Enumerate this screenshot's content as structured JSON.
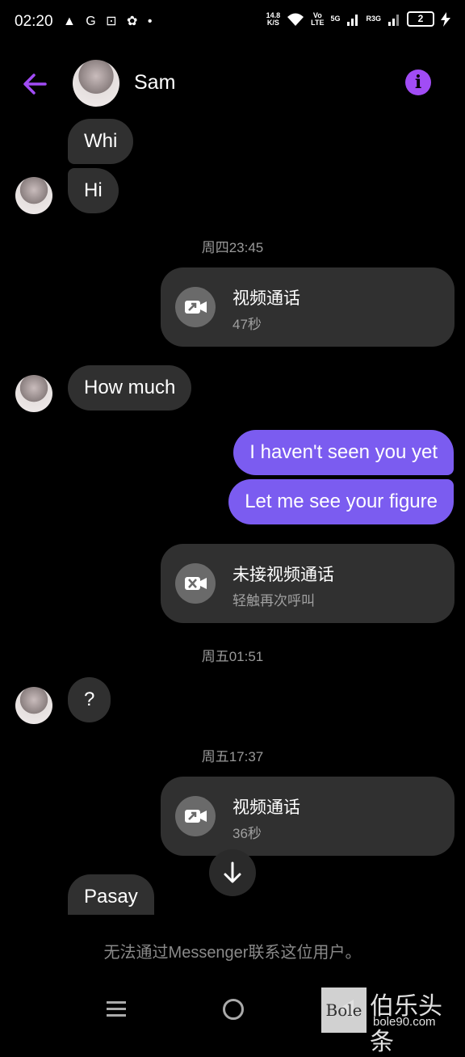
{
  "status": {
    "time": "02:20",
    "net_speed_top": "14.8",
    "net_speed_bottom": "K/S",
    "volte_top": "Vo",
    "volte_bottom": "LTE",
    "g5": "5G",
    "r3g": "R3G",
    "battery": "2",
    "left_icons": "▲ G ⊡ ✿ •"
  },
  "header": {
    "name": "Sam"
  },
  "messages": {
    "m1": "Whi",
    "m2": "Hi",
    "ts1": "周四23:45",
    "call1_title": "视频通话",
    "call1_sub": "47秒",
    "m3": "How much",
    "m4": "I haven't seen you yet",
    "m5": "Let me see your figure",
    "call2_title": "未接视频通话",
    "call2_sub": "轻触再次呼叫",
    "ts2": "周五01:51",
    "m6": "?",
    "ts3": "周五17:37",
    "call3_title": "视频通话",
    "call3_sub": "36秒",
    "m7": "Pasay"
  },
  "footer": {
    "unavailable": "无法通过Messenger联系这位用户。"
  },
  "watermark": {
    "logo": "Bole",
    "title": "伯乐头条",
    "url": "bole90.com"
  },
  "colors": {
    "accent": "#a14cf5",
    "outgoing_bubble": "#7b5cf0",
    "incoming_bubble": "#303030"
  }
}
